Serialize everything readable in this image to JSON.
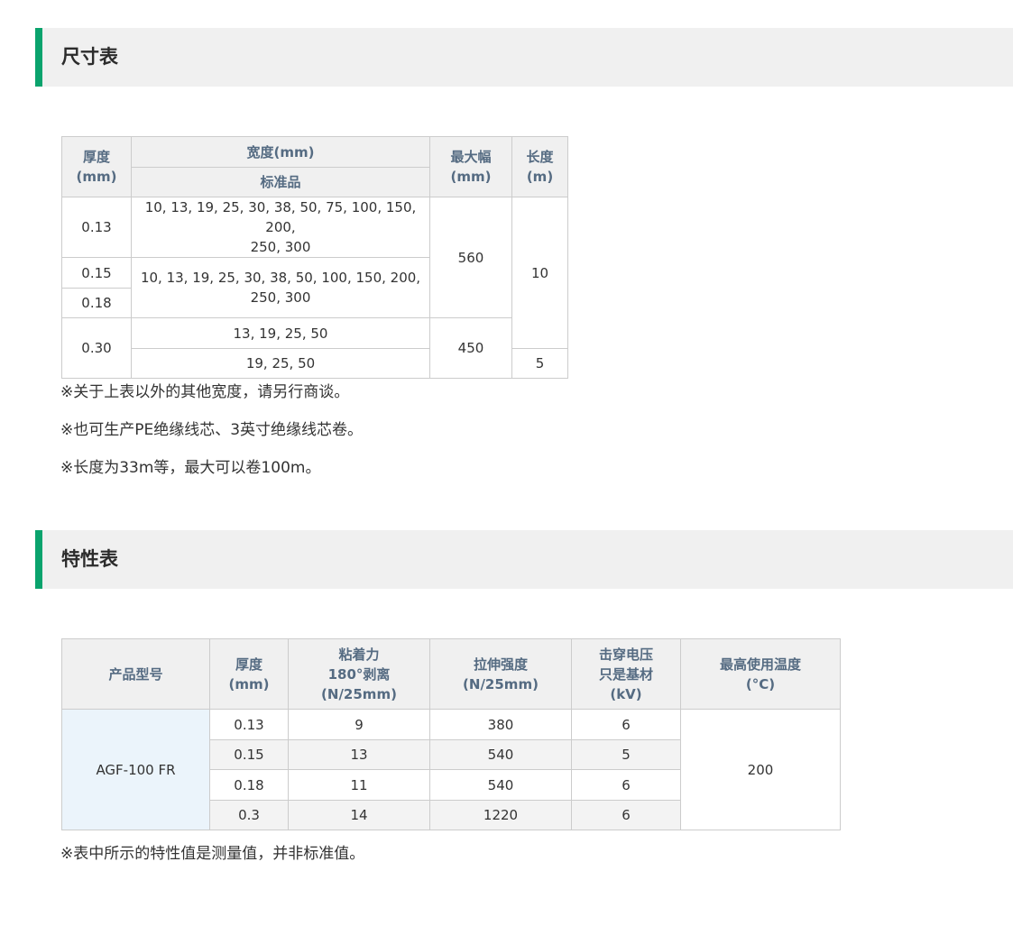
{
  "size_section": {
    "title": "尺寸表",
    "headers": {
      "thickness": "厚度\n(mm)",
      "width": "宽度(mm)",
      "standard": "标准品",
      "max_width": "最大幅\n(mm)",
      "length": "长度\n(m)"
    },
    "rows": {
      "t1": "0.13",
      "w1": "10, 13, 19, 25, 30, 38, 50, 75, 100, 150, 200,\n250, 300",
      "mw1": "560",
      "l1": "10",
      "t2": "0.15",
      "w2": "10, 13, 19, 25, 30, 38, 50, 100, 150, 200,\n250, 300",
      "t3": "0.18",
      "t4": "0.30",
      "w4a": "13, 19, 25, 50",
      "w4b": "19, 25, 50",
      "mw4": "450",
      "l4": "5"
    },
    "notes": [
      "※关于上表以外的其他宽度，请另行商谈。",
      "※也可生产PE绝缘线芯、3英寸绝缘线芯卷。",
      "※长度为33m等，最大可以卷100m。"
    ]
  },
  "props_section": {
    "title": "特性表",
    "headers": {
      "model": "产品型号",
      "thickness": "厚度\n(mm)",
      "adhesion": "粘着力\n180°剥离\n(N/25mm)",
      "tensile": "拉伸强度\n(N/25mm)",
      "breakdown": "击穿电压\n只是基材\n(kV)",
      "max_temp": "最高使用温度\n(°C)"
    },
    "model": "AGF-100 FR",
    "max_temp": "200",
    "rows": [
      {
        "thickness": "0.13",
        "adhesion": "9",
        "tensile": "380",
        "breakdown": "6"
      },
      {
        "thickness": "0.15",
        "adhesion": "13",
        "tensile": "540",
        "breakdown": "5"
      },
      {
        "thickness": "0.18",
        "adhesion": "11",
        "tensile": "540",
        "breakdown": "6"
      },
      {
        "thickness": "0.3",
        "adhesion": "14",
        "tensile": "1220",
        "breakdown": "6"
      }
    ],
    "note": "※表中所示的特性值是测量值，并非标准值。"
  },
  "colors": {
    "accent": "#0aa36d",
    "header_bg": "#f0f0f0",
    "header_text": "#556b82",
    "product_bg": "#ebf4fb"
  }
}
